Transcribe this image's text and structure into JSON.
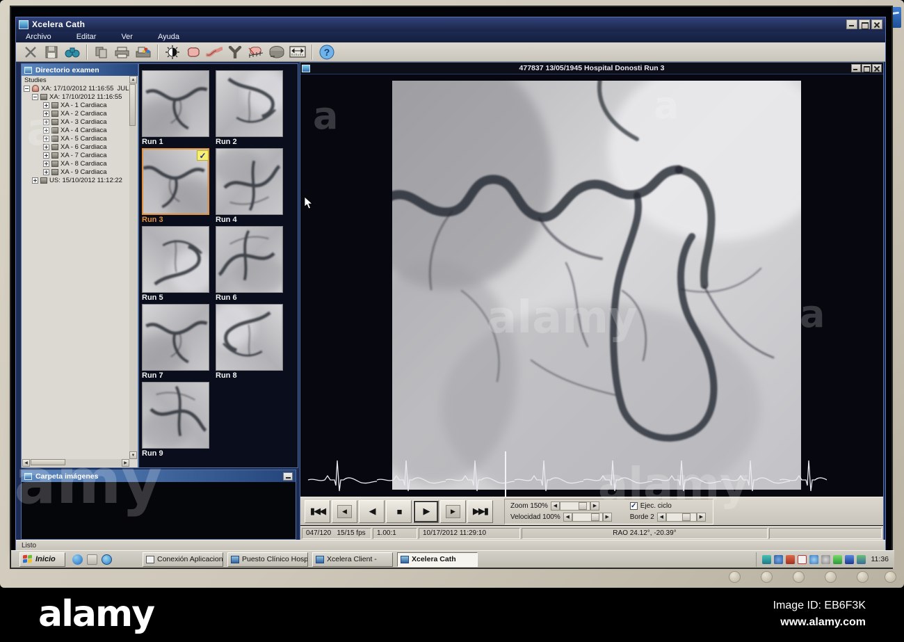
{
  "window": {
    "title": "Xcelera Cath",
    "menu": [
      "Archivo",
      "Editar",
      "Ver",
      "Ayuda"
    ],
    "status": "Listo"
  },
  "directory": {
    "title": "Directorio examen",
    "root": "Studies",
    "patient": "XA: 17/10/2012 11:16:55",
    "patient_suffix": "JULI",
    "study": "XA: 17/10/2012 11:16:55",
    "series": [
      "XA - 1 Cardiaca",
      "XA - 2 Cardiaca",
      "XA - 3 Cardiaca",
      "XA - 4 Cardiaca",
      "XA - 5 Cardiaca",
      "XA - 6 Cardiaca",
      "XA - 7 Cardiaca",
      "XA - 8 Cardiaca",
      "XA - 9 Cardiaca"
    ],
    "other_study": "US: 15/10/2012 11:12:22"
  },
  "images_panel": {
    "title": "Carpeta imágenes"
  },
  "thumbnails": [
    {
      "label": "Run 1"
    },
    {
      "label": "Run 2"
    },
    {
      "label": "Run 3"
    },
    {
      "label": "Run 4"
    },
    {
      "label": "Run 5"
    },
    {
      "label": "Run 6"
    },
    {
      "label": "Run 7"
    },
    {
      "label": "Run 8"
    },
    {
      "label": "Run 9"
    }
  ],
  "viewer": {
    "title": "477837 13/05/1945 Hospital Donosti Run 3",
    "controls": {
      "zoom_label": "Zoom 150%",
      "speed_label": "Velocidad 100%",
      "cycle_label": "Ejec. ciclo",
      "border_label": "Borde 2"
    },
    "status": {
      "frame": "047/120   15/15 fps",
      "ratio": "1.00:1",
      "datetime": "10/17/2012 11:29:10",
      "angle": "RAO 24.12°, -20.39°"
    }
  },
  "taskbar": {
    "start": "Inicio",
    "tasks": [
      "Conexión Aplicaciones O...",
      "Puesto Clínico Hospitalari...",
      "Xcelera Client -",
      "Xcelera Cath"
    ],
    "clock": "11:36"
  },
  "alamy": {
    "brand": "alamy",
    "image_id": "Image ID: EB6F3K",
    "url": "www.alamy.com"
  }
}
